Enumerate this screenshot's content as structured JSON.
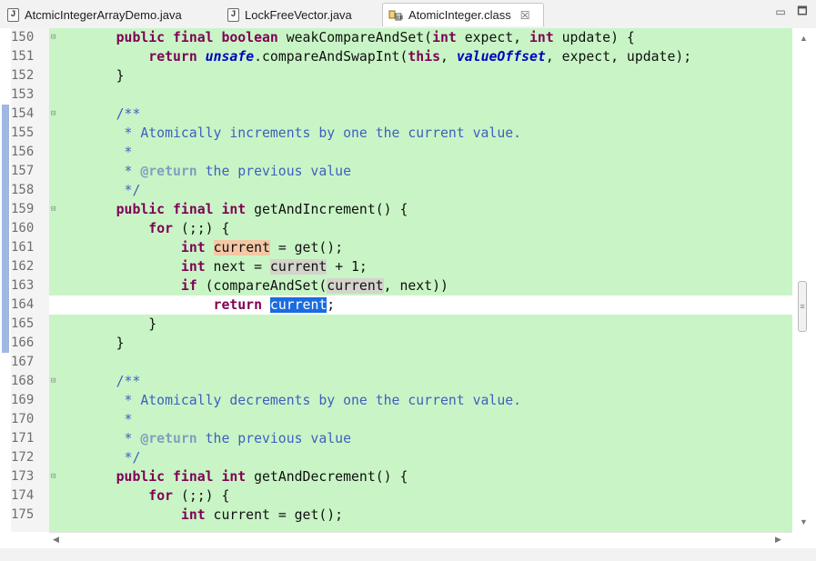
{
  "tabs": [
    {
      "label": "AtcmicIntegerArrayDemo.java",
      "icon": "java-file-icon",
      "active": false
    },
    {
      "label": "LockFreeVector.java",
      "icon": "java-file-icon",
      "active": false
    },
    {
      "label": "AtomicInteger.class",
      "icon": "class-file-icon",
      "active": true,
      "close": "☒"
    }
  ],
  "window_buttons": {
    "minimize": "▭",
    "maximize": "🗖"
  },
  "colors": {
    "editor_bg": "#c9f5c6",
    "keyword": "#7f0055",
    "comment": "#3f5fbf",
    "field": "#0000c0",
    "selection": "#1a6ce0"
  },
  "current_line": "164",
  "lines": [
    {
      "num": "150",
      "fold": true,
      "parts": [
        [
          "    ",
          ""
        ],
        [
          "public final boolean",
          "kw"
        ],
        [
          " weakCompareAndSet(",
          ""
        ],
        [
          "int",
          "kw"
        ],
        [
          " expect, ",
          ""
        ],
        [
          "int",
          "kw"
        ],
        [
          " update) {",
          ""
        ]
      ]
    },
    {
      "num": "151",
      "parts": [
        [
          "        ",
          ""
        ],
        [
          "return",
          "kw"
        ],
        [
          " ",
          ""
        ],
        [
          "unsafe",
          "fld"
        ],
        [
          ".compareAndSwapInt(",
          ""
        ],
        [
          "this",
          "kw"
        ],
        [
          ", ",
          ""
        ],
        [
          "valueOffset",
          "fld"
        ],
        [
          ", expect, update);",
          ""
        ]
      ]
    },
    {
      "num": "152",
      "parts": [
        [
          "    }",
          ""
        ]
      ]
    },
    {
      "num": "153",
      "parts": []
    },
    {
      "num": "154",
      "fold": true,
      "parts": [
        [
          "    /**",
          "cm"
        ]
      ]
    },
    {
      "num": "155",
      "parts": [
        [
          "     * Atomically increments by one the current value.",
          "cm"
        ]
      ]
    },
    {
      "num": "156",
      "parts": [
        [
          "     *",
          "cm"
        ]
      ]
    },
    {
      "num": "157",
      "parts": [
        [
          "     * ",
          "cm"
        ],
        [
          "@return",
          "tag"
        ],
        [
          " the previous value",
          "cm"
        ]
      ]
    },
    {
      "num": "158",
      "parts": [
        [
          "     */",
          "cm"
        ]
      ]
    },
    {
      "num": "159",
      "fold": true,
      "parts": [
        [
          "    ",
          ""
        ],
        [
          "public final int",
          "kw"
        ],
        [
          " getAndIncrement() {",
          ""
        ]
      ]
    },
    {
      "num": "160",
      "parts": [
        [
          "        ",
          ""
        ],
        [
          "for",
          "kw"
        ],
        [
          " (;;) {",
          ""
        ]
      ]
    },
    {
      "num": "161",
      "parts": [
        [
          "            ",
          ""
        ],
        [
          "int",
          "kw"
        ],
        [
          " ",
          ""
        ],
        [
          "current",
          "hlr"
        ],
        [
          " = get();",
          ""
        ]
      ]
    },
    {
      "num": "162",
      "parts": [
        [
          "            ",
          ""
        ],
        [
          "int",
          "kw"
        ],
        [
          " next = ",
          ""
        ],
        [
          "current",
          "hlg"
        ],
        [
          " + 1;",
          ""
        ]
      ]
    },
    {
      "num": "163",
      "parts": [
        [
          "            ",
          ""
        ],
        [
          "if",
          "kw"
        ],
        [
          " (compareAndSet(",
          ""
        ],
        [
          "current",
          "hlg"
        ],
        [
          ", next))",
          ""
        ]
      ]
    },
    {
      "num": "164",
      "parts": [
        [
          "                ",
          ""
        ],
        [
          "return",
          "kw"
        ],
        [
          " ",
          ""
        ],
        [
          "current",
          "sel"
        ],
        [
          ";",
          ""
        ]
      ]
    },
    {
      "num": "165",
      "parts": [
        [
          "        }",
          ""
        ]
      ]
    },
    {
      "num": "166",
      "parts": [
        [
          "    }",
          ""
        ]
      ]
    },
    {
      "num": "167",
      "parts": []
    },
    {
      "num": "168",
      "fold": true,
      "parts": [
        [
          "    /**",
          "cm"
        ]
      ]
    },
    {
      "num": "169",
      "parts": [
        [
          "     * Atomically decrements by one the current value.",
          "cm"
        ]
      ]
    },
    {
      "num": "170",
      "parts": [
        [
          "     *",
          "cm"
        ]
      ]
    },
    {
      "num": "171",
      "parts": [
        [
          "     * ",
          "cm"
        ],
        [
          "@return",
          "tag"
        ],
        [
          " the previous value",
          "cm"
        ]
      ]
    },
    {
      "num": "172",
      "parts": [
        [
          "     */",
          "cm"
        ]
      ]
    },
    {
      "num": "173",
      "fold": true,
      "parts": [
        [
          "    ",
          ""
        ],
        [
          "public final int",
          "kw"
        ],
        [
          " getAndDecrement() {",
          ""
        ]
      ]
    },
    {
      "num": "174",
      "parts": [
        [
          "        ",
          ""
        ],
        [
          "for",
          "kw"
        ],
        [
          " (;;) {",
          ""
        ]
      ]
    },
    {
      "num": "175",
      "parts": [
        [
          "            ",
          ""
        ],
        [
          "int",
          "kw"
        ],
        [
          " current = get();",
          ""
        ]
      ]
    }
  ],
  "scroll_arrows": {
    "up": "▲",
    "down": "▼",
    "left": "◀",
    "right": "▶",
    "grip": "≡"
  }
}
